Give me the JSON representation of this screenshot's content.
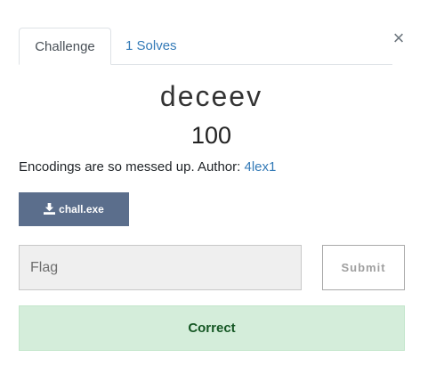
{
  "modal": {
    "close_glyph": "×"
  },
  "tabs": [
    {
      "label": "Challenge",
      "active": true
    },
    {
      "label": "1 Solves",
      "active": false
    }
  ],
  "challenge": {
    "name": "deceev",
    "value": "100",
    "description": "Encodings are so messed up. Author: ",
    "author": "4lex1"
  },
  "files": [
    {
      "name": "chall.exe",
      "icon": "download-icon"
    }
  ],
  "submission": {
    "flag_placeholder": "Flag",
    "flag_value": "",
    "submit_label": "Submit",
    "result_message": "Correct"
  },
  "colors": {
    "link": "#337ab7",
    "file_button": "#5b6e8c",
    "success_bg": "#d4edda",
    "success_text": "#155724"
  }
}
